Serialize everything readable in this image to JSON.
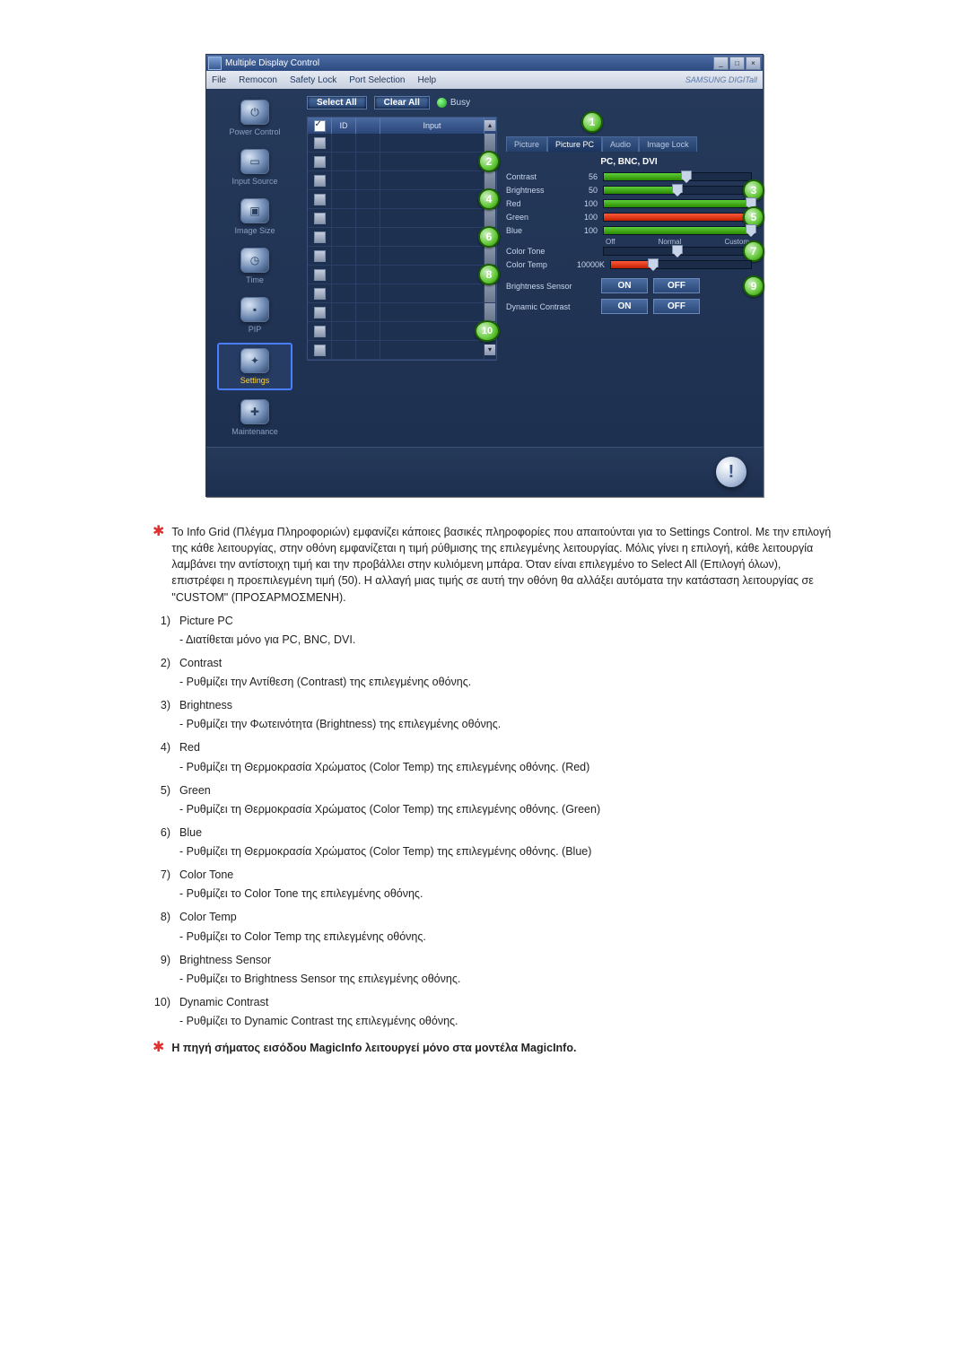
{
  "window": {
    "title": "Multiple Display Control",
    "brand": "SAMSUNG DIGITall",
    "menus": [
      "File",
      "Remocon",
      "Safety Lock",
      "Port Selection",
      "Help"
    ]
  },
  "sidebar": [
    {
      "label": "Power Control",
      "glyph": "⏻"
    },
    {
      "label": "Input Source",
      "glyph": "▭"
    },
    {
      "label": "Image Size",
      "glyph": "▣"
    },
    {
      "label": "Time",
      "glyph": "◷"
    },
    {
      "label": "PIP",
      "glyph": "▪"
    },
    {
      "label": "Settings",
      "glyph": "✦",
      "active": true
    },
    {
      "label": "Maintenance",
      "glyph": "✚"
    }
  ],
  "toolbar": {
    "select_all": "Select All",
    "clear_all": "Clear All",
    "busy": "Busy"
  },
  "grid": {
    "headers": {
      "id": "ID",
      "input": "Input"
    }
  },
  "tabs": [
    "Picture",
    "Picture PC",
    "Audio",
    "Image Lock"
  ],
  "tabs_active": 1,
  "subheader": "PC, BNC, DVI",
  "sliders": {
    "contrast": {
      "label": "Contrast",
      "value": 56,
      "pct": 56,
      "color": "green"
    },
    "brightness": {
      "label": "Brightness",
      "value": 50,
      "pct": 50,
      "color": "green"
    },
    "red": {
      "label": "Red",
      "value": 100,
      "pct": 100,
      "color": "green"
    },
    "green": {
      "label": "Green",
      "value": 100,
      "pct": 100,
      "color": "red"
    },
    "blue": {
      "label": "Blue",
      "value": 100,
      "pct": 100,
      "color": "green"
    },
    "color_tone": {
      "label": "Color Tone",
      "value_text": "",
      "pct": 50,
      "marks": [
        "Off",
        "Normal",
        "Custom"
      ]
    },
    "color_temp": {
      "label": "Color Temp",
      "value_text": "10000K",
      "pct": 30
    }
  },
  "toggles": {
    "brightness_sensor": {
      "label": "Brightness Sensor",
      "on": "ON",
      "off": "OFF"
    },
    "dynamic_contrast": {
      "label": "Dynamic Contrast",
      "on": "ON",
      "off": "OFF"
    }
  },
  "badges": [
    "1",
    "2",
    "3",
    "4",
    "5",
    "6",
    "7",
    "8",
    "9",
    "10"
  ],
  "doc": {
    "intro": "Το Info Grid (Πλέγμα Πληροφοριών) εμφανίζει κάποιες βασικές πληροφορίες που απαιτούνται για το Settings Control. Με την επιλογή της κάθε λειτουργίας, στην οθόνη εμφανίζεται η τιμή ρύθμισης της επιλεγμένης λειτουργίας. Μόλις γίνει η επιλογή, κάθε λειτουργία λαμβάνει την αντίστοιχη τιμή και την προβάλλει στην κυλιόμενη μπάρα. Όταν είναι επιλεγμένο το Select All (Επιλογή όλων), επιστρέφει η προεπιλεγμένη τιμή (50). Η αλλαγή μιας τιμής σε αυτή την οθόνη θα αλλάξει αυτόματα την κατάσταση λειτουργίας σε \"CUSTOM\" (ΠΡΟΣΑΡΜΟΣΜΕΝΗ).",
    "items": [
      {
        "n": "1)",
        "t": "Picture PC",
        "d": "- Διατίθεται μόνο για PC, BNC, DVI."
      },
      {
        "n": "2)",
        "t": "Contrast",
        "d": "- Ρυθμίζει την Αντίθεση (Contrast) της επιλεγμένης οθόνης."
      },
      {
        "n": "3)",
        "t": "Brightness",
        "d": "- Ρυθμίζει την Φωτεινότητα (Brightness) της επιλεγμένης οθόνης."
      },
      {
        "n": "4)",
        "t": "Red",
        "d": "- Ρυθμίζει τη Θερμοκρασία Χρώματος (Color Temp) της επιλεγμένης οθόνης. (Red)"
      },
      {
        "n": "5)",
        "t": "Green",
        "d": "- Ρυθμίζει τη Θερμοκρασία Χρώματος (Color Temp) της επιλεγμένης οθόνης. (Green)"
      },
      {
        "n": "6)",
        "t": "Blue",
        "d": "- Ρυθμίζει τη Θερμοκρασία Χρώματος (Color Temp) της επιλεγμένης οθόνης. (Blue)"
      },
      {
        "n": "7)",
        "t": "Color Tone",
        "d": "- Ρυθμίζει το Color Tone της επιλεγμένης οθόνης."
      },
      {
        "n": "8)",
        "t": "Color Temp",
        "d": "- Ρυθμίζει το Color Temp της επιλεγμένης οθόνης."
      },
      {
        "n": "9)",
        "t": "Brightness Sensor",
        "d": "- Ρυθμίζει το Brightness Sensor της επιλεγμένης οθόνης."
      },
      {
        "n": "10)",
        "t": "Dynamic Contrast",
        "d": "- Ρυθμίζει το Dynamic Contrast της επιλεγμένης οθόνης."
      }
    ],
    "footnote": "Η πηγή σήματος εισόδου MagicInfo λειτουργεί μόνο στα μοντέλα MagicInfo."
  }
}
